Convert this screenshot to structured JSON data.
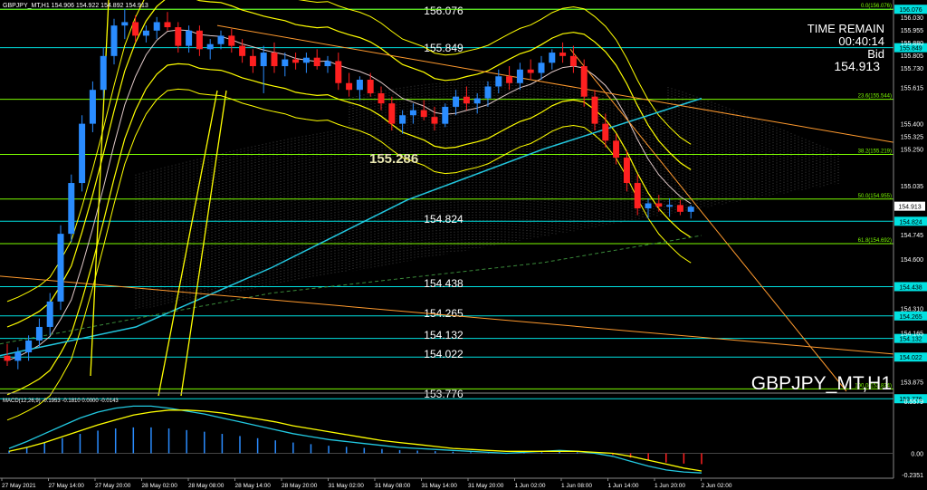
{
  "header": {
    "symbol_line": "GBPJPY_MT,H1  154.906 154.922 154.892 154.913"
  },
  "info_panel": {
    "time_remain_label": "TIME REMAIN",
    "time_remain_value": "00:40:14",
    "bid_label": "Bid",
    "bid_value": "154.913"
  },
  "watermark": "GBPJPY_MT,H1",
  "big_label": "155.286",
  "colors": {
    "background": "#000000",
    "bull_candle": "#2a8cff",
    "bear_candle": "#ff2020",
    "horizontal_level": "#00e0e0",
    "fib_line": "#7cfc00",
    "bollinger": "#ffff00",
    "ma_long": "#22c8e0",
    "trendline": "#ff9a2e",
    "macd_main": "#22c8e0",
    "macd_signal": "#ffff00"
  },
  "chart_data": [
    {
      "type": "candlestick",
      "ylim": [
        153.82,
        156.12
      ],
      "x_ticks": [
        "27 May 2021",
        "27 May 14:00",
        "27 May 20:00",
        "28 May 02:00",
        "28 May 08:00",
        "28 May 14:00",
        "28 May 20:00",
        "31 May 02:00",
        "31 May 08:00",
        "31 May 14:00",
        "31 May 20:00",
        "1 Jun 02:00",
        "1 Jun 08:00",
        "1 Jun 14:00",
        "1 Jun 20:00",
        "2 Jun 02:00"
      ],
      "y_ticks": [
        "156.030",
        "155.955",
        "155.880",
        "155.805",
        "155.730",
        "155.615",
        "155.400",
        "155.325",
        "155.250",
        "155.035",
        "154.745",
        "154.600",
        "154.310",
        "154.165",
        "153.875"
      ],
      "horizontal_levels": [
        {
          "value": 155.849,
          "label": "155.849"
        },
        {
          "value": 154.824,
          "label": "154.824"
        },
        {
          "value": 154.438,
          "label": "154.438"
        },
        {
          "value": 154.265,
          "label": "154.265"
        },
        {
          "value": 154.132,
          "label": "154.132"
        },
        {
          "value": 154.022,
          "label": "154.022"
        },
        {
          "value": 153.776,
          "label": "153.776"
        },
        {
          "value": 156.076,
          "label": "156.076"
        }
      ],
      "fib_levels": [
        {
          "value": 156.076,
          "label": "0.0(156.076)",
          "axis_tag": "156.076"
        },
        {
          "value": 155.544,
          "label": "23.6(155.544)",
          "axis_tag": ""
        },
        {
          "value": 155.219,
          "label": "38.2(155.219)",
          "axis_tag": ""
        },
        {
          "value": 154.955,
          "label": "50.0(154.955)",
          "axis_tag": ""
        },
        {
          "value": 154.692,
          "label": "61.8(154.692)",
          "axis_tag": ""
        },
        {
          "value": 153.834,
          "label": "100.0(153.834)",
          "axis_tag": ""
        }
      ],
      "current_price": 154.913,
      "candles": [
        [
          154.03,
          154.1,
          153.97,
          154.0
        ],
        [
          154.0,
          154.08,
          153.95,
          154.05
        ],
        [
          154.05,
          154.15,
          154.0,
          154.12
        ],
        [
          154.12,
          154.25,
          154.08,
          154.2
        ],
        [
          154.2,
          154.4,
          154.15,
          154.35
        ],
        [
          154.35,
          154.8,
          154.3,
          154.75
        ],
        [
          154.75,
          155.1,
          154.7,
          155.05
        ],
        [
          155.05,
          155.45,
          155.0,
          155.4
        ],
        [
          155.4,
          155.65,
          155.35,
          155.6
        ],
        [
          155.6,
          155.85,
          155.55,
          155.8
        ],
        [
          155.8,
          156.02,
          155.75,
          155.98
        ],
        [
          155.98,
          156.08,
          155.9,
          156.0
        ],
        [
          156.0,
          156.04,
          155.88,
          155.92
        ],
        [
          155.92,
          155.98,
          155.88,
          155.95
        ],
        [
          155.95,
          156.03,
          155.9,
          156.0
        ],
        [
          156.0,
          156.06,
          155.95,
          155.97
        ],
        [
          155.97,
          156.0,
          155.82,
          155.86
        ],
        [
          155.86,
          155.98,
          155.82,
          155.95
        ],
        [
          155.95,
          155.98,
          155.8,
          155.84
        ],
        [
          155.84,
          155.9,
          155.78,
          155.87
        ],
        [
          155.87,
          155.95,
          155.84,
          155.92
        ],
        [
          155.92,
          155.96,
          155.82,
          155.86
        ],
        [
          155.86,
          155.9,
          155.76,
          155.8
        ],
        [
          155.8,
          155.84,
          155.7,
          155.74
        ],
        [
          155.74,
          155.86,
          155.58,
          155.82
        ],
        [
          155.82,
          155.88,
          155.7,
          155.74
        ],
        [
          155.74,
          155.82,
          155.68,
          155.78
        ],
        [
          155.78,
          155.82,
          155.72,
          155.76
        ],
        [
          155.76,
          155.82,
          155.7,
          155.79
        ],
        [
          155.79,
          155.84,
          155.72,
          155.74
        ],
        [
          155.74,
          155.8,
          155.7,
          155.77
        ],
        [
          155.77,
          155.82,
          155.6,
          155.64
        ],
        [
          155.64,
          155.7,
          155.56,
          155.6
        ],
        [
          155.6,
          155.68,
          155.54,
          155.66
        ],
        [
          155.66,
          155.7,
          155.56,
          155.58
        ],
        [
          155.58,
          155.62,
          155.48,
          155.52
        ],
        [
          155.52,
          155.56,
          155.36,
          155.4
        ],
        [
          155.4,
          155.48,
          155.34,
          155.45
        ],
        [
          155.45,
          155.52,
          155.4,
          155.48
        ],
        [
          155.48,
          155.54,
          155.42,
          155.44
        ],
        [
          155.44,
          155.5,
          155.36,
          155.4
        ],
        [
          155.4,
          155.52,
          155.38,
          155.5
        ],
        [
          155.5,
          155.6,
          155.45,
          155.56
        ],
        [
          155.56,
          155.62,
          155.48,
          155.52
        ],
        [
          155.52,
          155.58,
          155.46,
          155.55
        ],
        [
          155.55,
          155.65,
          155.5,
          155.62
        ],
        [
          155.62,
          155.72,
          155.58,
          155.68
        ],
        [
          155.68,
          155.74,
          155.6,
          155.64
        ],
        [
          155.64,
          155.76,
          155.6,
          155.72
        ],
        [
          155.72,
          155.78,
          155.66,
          155.7
        ],
        [
          155.7,
          155.8,
          155.66,
          155.76
        ],
        [
          155.76,
          155.84,
          155.72,
          155.82
        ],
        [
          155.82,
          155.88,
          155.76,
          155.8
        ],
        [
          155.8,
          155.86,
          155.7,
          155.74
        ],
        [
          155.74,
          155.78,
          155.5,
          155.56
        ],
        [
          155.56,
          155.6,
          155.36,
          155.4
        ],
        [
          155.4,
          155.46,
          155.26,
          155.3
        ],
        [
          155.3,
          155.34,
          155.16,
          155.2
        ],
        [
          155.2,
          155.24,
          155.0,
          155.05
        ],
        [
          155.05,
          155.1,
          154.86,
          154.9
        ],
        [
          154.9,
          154.96,
          154.84,
          154.93
        ],
        [
          154.93,
          154.98,
          154.88,
          154.91
        ],
        [
          154.91,
          154.96,
          154.85,
          154.92
        ],
        [
          154.92,
          154.95,
          154.86,
          154.88
        ],
        [
          154.88,
          154.92,
          154.84,
          154.91
        ]
      ]
    },
    {
      "type": "bar",
      "title": "MACD(12,26,9) -0.1953 -0.1810 0.0000 -0.0143",
      "ylim": [
        -0.2351,
        0.5579
      ],
      "y_ticks": [
        "0.5579",
        "0.00",
        "-0.2351"
      ],
      "series": [
        {
          "name": "MACD",
          "values": [
            0.05,
            0.12,
            0.2,
            0.28,
            0.36,
            0.42,
            0.46,
            0.48,
            0.48,
            0.46,
            0.43,
            0.4,
            0.36,
            0.32,
            0.28,
            0.24,
            0.2,
            0.17,
            0.14,
            0.12,
            0.1,
            0.08,
            0.06,
            0.05,
            0.04,
            0.03,
            0.02,
            0.01,
            0.0,
            0.01,
            0.02,
            0.03,
            0.02,
            0.0,
            -0.03,
            -0.08,
            -0.13,
            -0.17,
            -0.19,
            -0.2
          ]
        },
        {
          "name": "Signal",
          "values": [
            0.02,
            0.06,
            0.11,
            0.17,
            0.23,
            0.29,
            0.34,
            0.39,
            0.42,
            0.44,
            0.44,
            0.43,
            0.41,
            0.38,
            0.35,
            0.32,
            0.28,
            0.25,
            0.22,
            0.19,
            0.16,
            0.13,
            0.11,
            0.09,
            0.07,
            0.05,
            0.04,
            0.03,
            0.02,
            0.02,
            0.02,
            0.02,
            0.02,
            0.01,
            0.0,
            -0.03,
            -0.07,
            -0.11,
            -0.15,
            -0.18
          ]
        }
      ]
    }
  ]
}
